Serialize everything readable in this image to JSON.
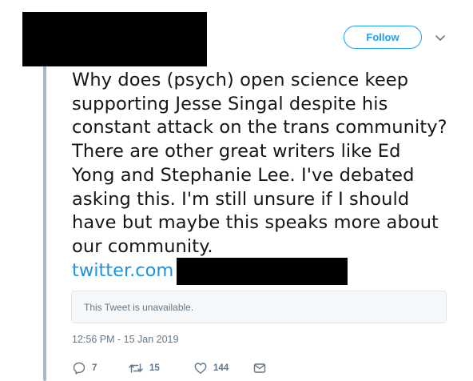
{
  "header": {
    "follow_label": "Follow",
    "caret_icon": "chevron-down-icon"
  },
  "tweet": {
    "lines": [
      "Why does (psych) open science keep",
      "supporting Jesse Singal despite his",
      "constant attack on the trans community?",
      "There are other great writers like Ed",
      "Yong and Stephanie Lee. I've debated",
      "asking this. I'm still unsure if I should",
      "have but maybe this speaks more about",
      "our community."
    ],
    "link_text": "twitter.com",
    "quote_unavailable": "This Tweet is unavailable.",
    "timestamp": "12:56 PM - 15 Jan 2019"
  },
  "actions": {
    "reply_count": "7",
    "retweet_count": "15",
    "like_count": "144",
    "reply_icon": "reply-icon",
    "retweet_icon": "retweet-icon",
    "like_icon": "heart-icon",
    "dm_icon": "envelope-icon"
  },
  "colors": {
    "accent": "#1da1f2",
    "link": "#1b95e0",
    "muted": "#657786",
    "thread_line": "#aab8c2"
  }
}
